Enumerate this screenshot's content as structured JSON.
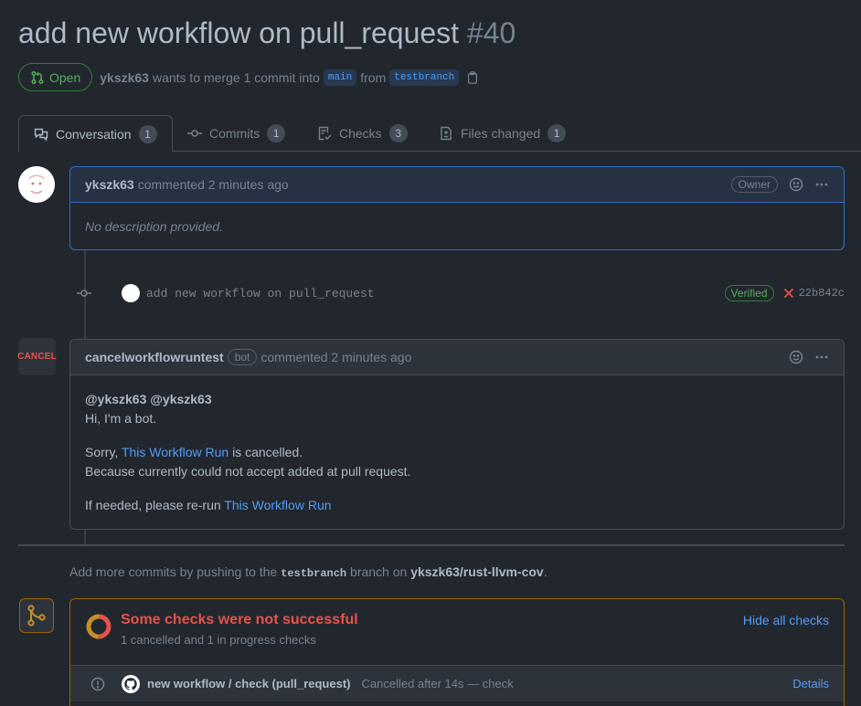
{
  "pr": {
    "title": "add new workflow on pull_request",
    "number": "#40",
    "state": "Open",
    "author": "ykszk63",
    "merge_text": "wants to merge 1 commit into",
    "base_branch": "main",
    "from_text": "from",
    "head_branch": "testbranch"
  },
  "tabs": [
    {
      "label": "Conversation",
      "count": "1",
      "icon": "comment-discussion-icon"
    },
    {
      "label": "Commits",
      "count": "1",
      "icon": "git-commit-icon"
    },
    {
      "label": "Checks",
      "count": "3",
      "icon": "checklist-icon"
    },
    {
      "label": "Files changed",
      "count": "1",
      "icon": "file-diff-icon"
    }
  ],
  "comment1": {
    "author": "ykszk63",
    "meta": "commented 2 minutes ago",
    "badge": "Owner",
    "body": "No description provided."
  },
  "commit": {
    "message": "add new workflow on pull_request",
    "verified": "Verified",
    "sha": "22b842c",
    "status_icon": "x-icon"
  },
  "comment2": {
    "avatar_text": "CANCEL",
    "author": "cancelworkflowruntest",
    "bot_badge": "bot",
    "meta": "commented 2 minutes ago",
    "mentions": "@ykszk63 @ykszk63",
    "line1": "Hi, I'm a bot.",
    "sorry": "Sorry,",
    "link1": "This Workflow Run",
    "cancelled": "is cancelled.",
    "line3": "Because currently could not accept added at pull request.",
    "rerun": "If needed, please re-run",
    "link2": "This Workflow Run"
  },
  "push_note": {
    "prefix": "Add more commits by pushing to the",
    "branch": "testbranch",
    "middle": "branch on",
    "repo": "ykszk63/rust-llvm-cov",
    "suffix": "."
  },
  "checks": {
    "title": "Some checks were not successful",
    "subtitle": "1 cancelled and 1 in progress checks",
    "hide_label": "Hide all checks",
    "ring_colors": {
      "cancelled": "#e5534b",
      "in_progress": "#c69026"
    },
    "rows": [
      {
        "name": "new workflow / check (pull_request)",
        "desc": "Cancelled after 14s — check",
        "link": "Details"
      }
    ]
  },
  "colors": {
    "background": "#22272e",
    "accent": "#539bf5",
    "success": "#57ab5a",
    "danger": "#e5534b",
    "warning_border": "#966600"
  }
}
